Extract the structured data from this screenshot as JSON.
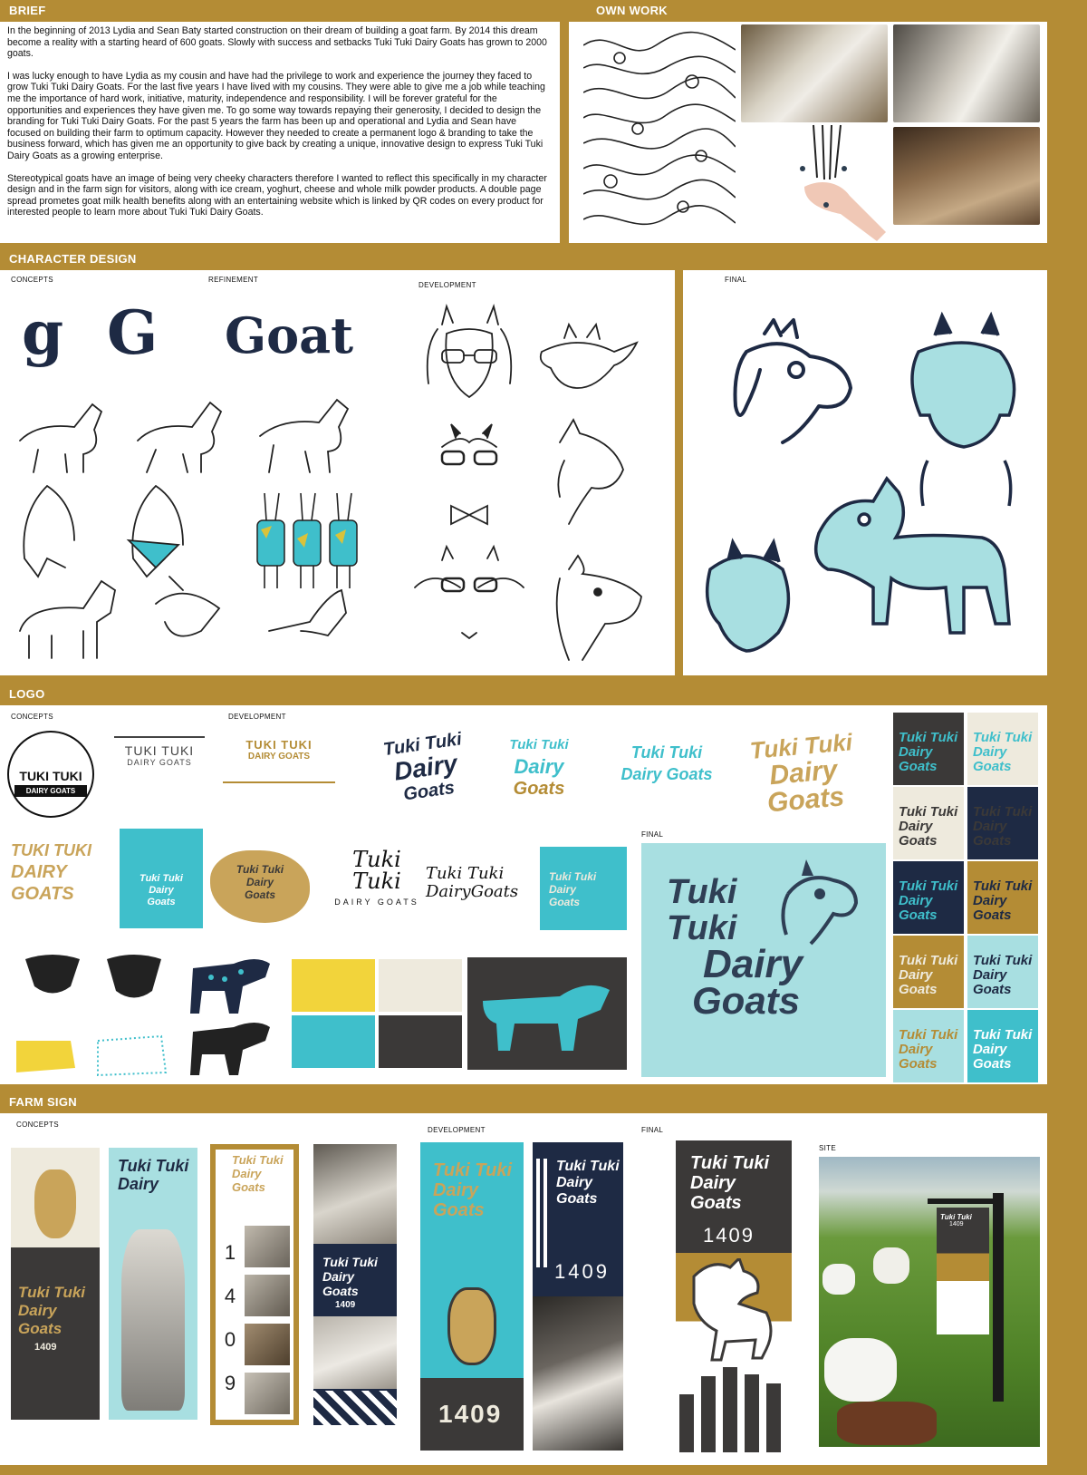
{
  "sections": {
    "brief": "BRIEF",
    "own_work": "OWN WORK",
    "character_design": "CHARACTER DESIGN",
    "logo": "LOGO",
    "farm_sign": "FARM SIGN"
  },
  "brief_paragraphs": [
    "In the beginning of 2013 Lydia and Sean Baty started construction on their dream of building a goat farm. By 2014 this dream become a reality with a starting heard of 600 goats. Slowly with success and setbacks Tuki Tuki Dairy Goats has grown to 2000 goats.",
    "I was lucky enough to have Lydia as my cousin and have had the privilege to work and experience the journey they faced to grow Tuki Tuki Dairy Goats. For the last five years I have lived with my cousins. They were able to give me a job while teaching me the importance of hard work, initiative, maturity, independence and responsibility. I will be forever grateful for the opportunities and experiences they have given me. To go some way towards repaying their generosity, I decided to design the branding for Tuki Tuki Dairy Goats. For the past 5 years the farm has been up and operational and Lydia and Sean have focused on building their farm to optimum capacity. However they needed to create a permanent logo & branding to take the business forward, which has given me an opportunity to give back by creating a unique, innovative design to express Tuki Tuki Dairy Goats as a growing enterprise.",
    "Stereotypical goats have an image of being very cheeky characters therefore I wanted to reflect this specifically in my character design and in the farm sign for visitors, along with ice cream, yoghurt, cheese and whole milk powder products. A double page spread prometes goat milk health benefits along with an entertaining website which is linked by QR codes on every product for interested people to learn more about Tuki Tuki Dairy Goats."
  ],
  "character": {
    "concepts": "CONCEPTS",
    "refinement": "REFINEMENT",
    "development": "DEVELOPMENT",
    "final": "FINAL",
    "letters": [
      "g",
      "G",
      "Goat"
    ]
  },
  "logo": {
    "concepts": "CONCEPTS",
    "development": "DEVELOPMENT",
    "final": "FINAL",
    "badge_top": "TUKI TUKI",
    "badge_bottom": "DAIRY GOATS",
    "outline_top": "TUKI TUKI",
    "outline_bottom": "DAIRY GOATS",
    "gold_top": "TUKI TUKI",
    "gold_bottom": "DAIRY GOATS",
    "script_lines": [
      "Tuki Tuki",
      "Dairy",
      "Goats"
    ],
    "final_lines": [
      "Tuki",
      "Tuki",
      "Dairy",
      "Goats"
    ],
    "dairy_goats_spaced": "DAIRY GOATS",
    "tuki": "Tuki"
  },
  "farm_sign": {
    "concepts": "CONCEPTS",
    "development": "DEVELOPMENT",
    "final": "FINAL",
    "site": "SITE",
    "number": "1409",
    "number_vertical": [
      "1",
      "4",
      "0",
      "9"
    ],
    "lines": [
      "Tuki Tuki",
      "Dairy",
      "Goats"
    ]
  },
  "colors": {
    "gold": "#b48c35",
    "navy": "#1e2a44",
    "teal": "#3fbfcb",
    "light_teal": "#a8dfe1",
    "cream": "#eeeadd",
    "charcoal": "#3b3938"
  }
}
